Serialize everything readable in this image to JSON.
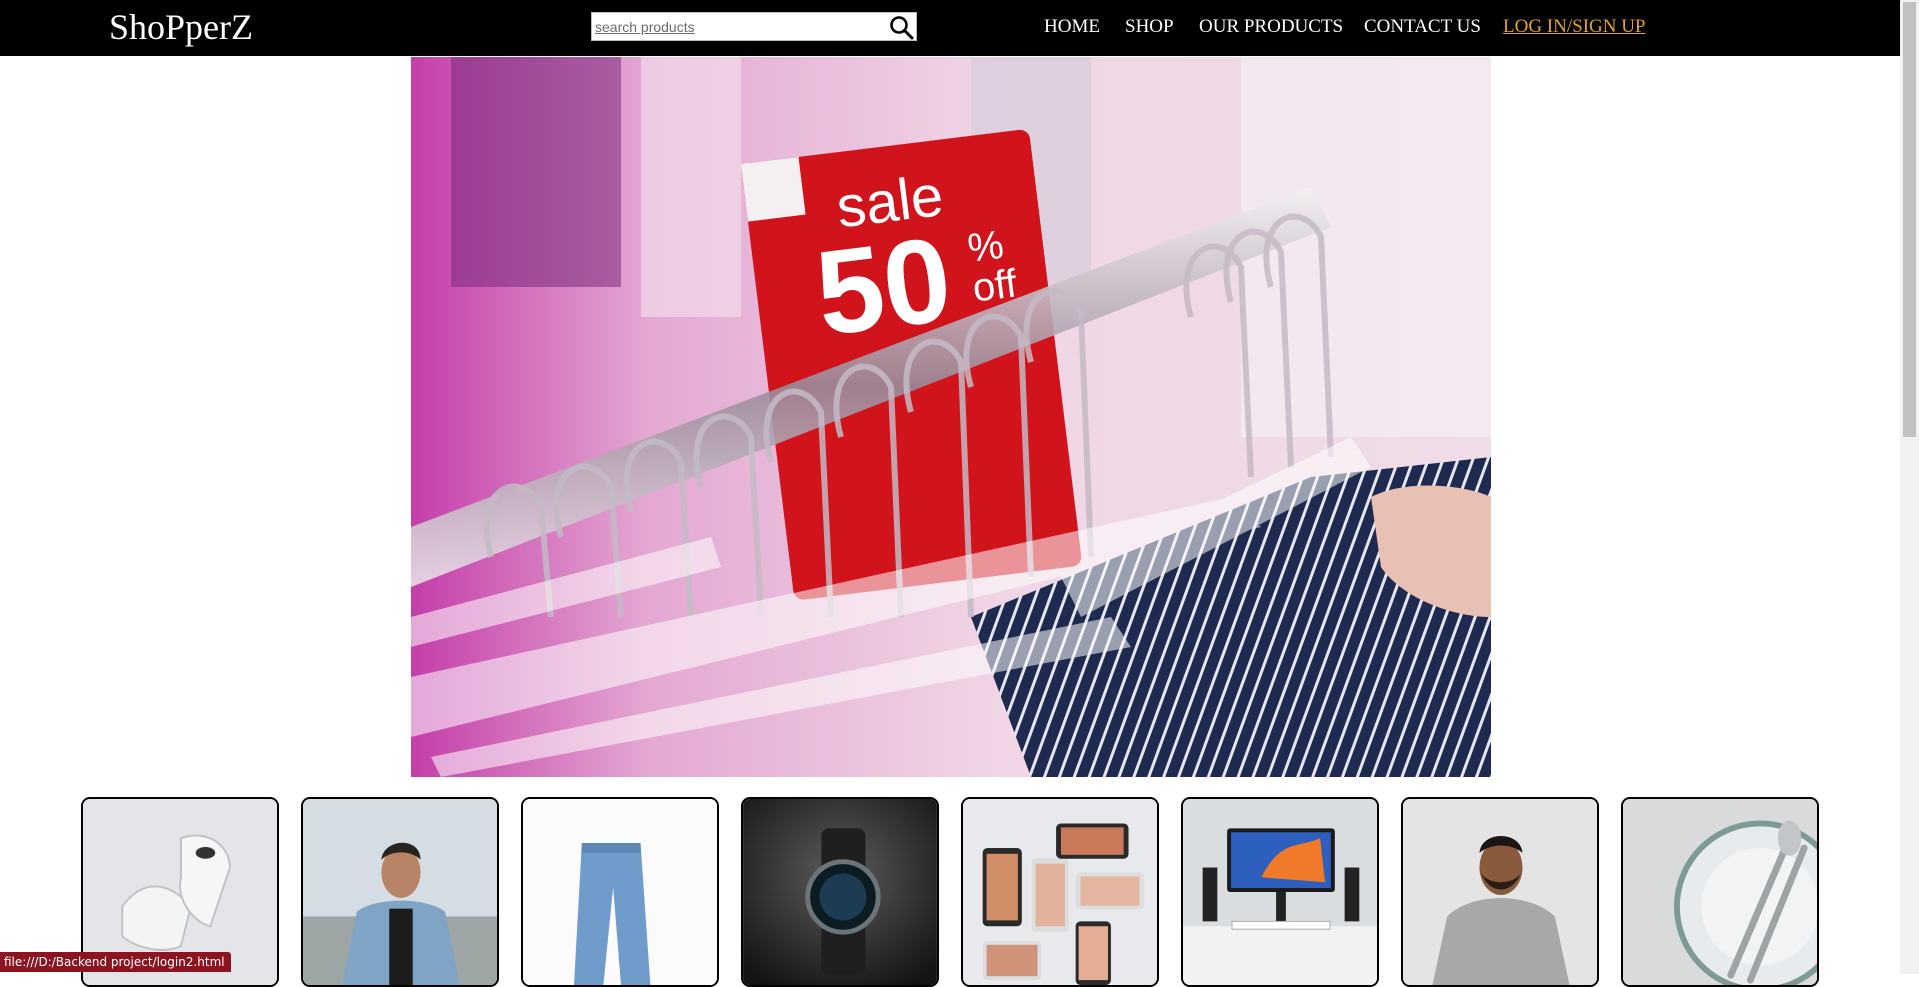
{
  "brand": {
    "name": "ShoPperZ"
  },
  "search": {
    "placeholder": "search products",
    "icon": "search-icon"
  },
  "nav": {
    "items": [
      {
        "label": "HOME"
      },
      {
        "label": "SHOP"
      },
      {
        "label": "OUR PRODUCTS"
      },
      {
        "label": "CONTACT US"
      },
      {
        "label": "LOG IN/SIGN UP"
      }
    ]
  },
  "hero": {
    "sign": {
      "word": "sale",
      "amount": "50",
      "percent": "%",
      "suffix": "off"
    },
    "colors": {
      "sign_red": "#d1131c",
      "background_pink": "#e8b8d6"
    }
  },
  "products": [
    {
      "name": "sneakers"
    },
    {
      "name": "denim-jacket-man"
    },
    {
      "name": "jeans"
    },
    {
      "name": "wristwatch"
    },
    {
      "name": "smartphones"
    },
    {
      "name": "desktop-setup"
    },
    {
      "name": "grey-hoodie-man"
    },
    {
      "name": "silverware"
    }
  ],
  "status_bar": {
    "url": "file:///D:/Backend project/login2.html"
  },
  "colors": {
    "nav_bg": "#000000",
    "nav_text": "#ffffff",
    "login_accent": "#e5a42b",
    "status_bg": "#8b1420"
  }
}
